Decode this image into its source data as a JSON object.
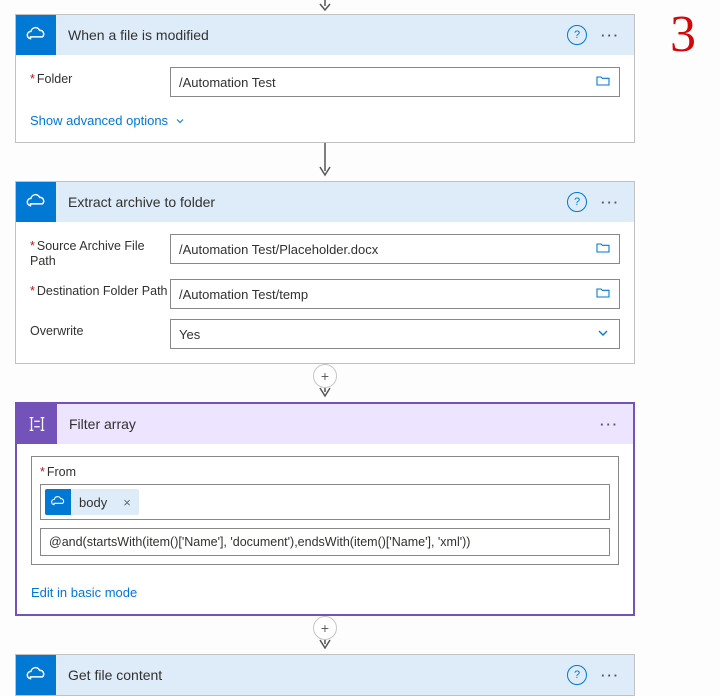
{
  "annotation": "3",
  "cards": {
    "trigger": {
      "title": "When a file is modified",
      "folder_label": "Folder",
      "folder_value": "/Automation Test",
      "advanced": "Show advanced options"
    },
    "extract": {
      "title": "Extract archive to folder",
      "src_label": "Source Archive File Path",
      "src_value": "/Automation Test/Placeholder.docx",
      "dst_label": "Destination Folder Path",
      "dst_value": "/Automation Test/temp",
      "ow_label": "Overwrite",
      "ow_value": "Yes"
    },
    "filter": {
      "title": "Filter array",
      "from_label": "From",
      "token_label": "body",
      "expression": "@and(startsWith(item()['Name'], 'document'),endsWith(item()['Name'], 'xml'))",
      "edit_link": "Edit in basic mode"
    },
    "getfile": {
      "title": "Get file content"
    }
  }
}
